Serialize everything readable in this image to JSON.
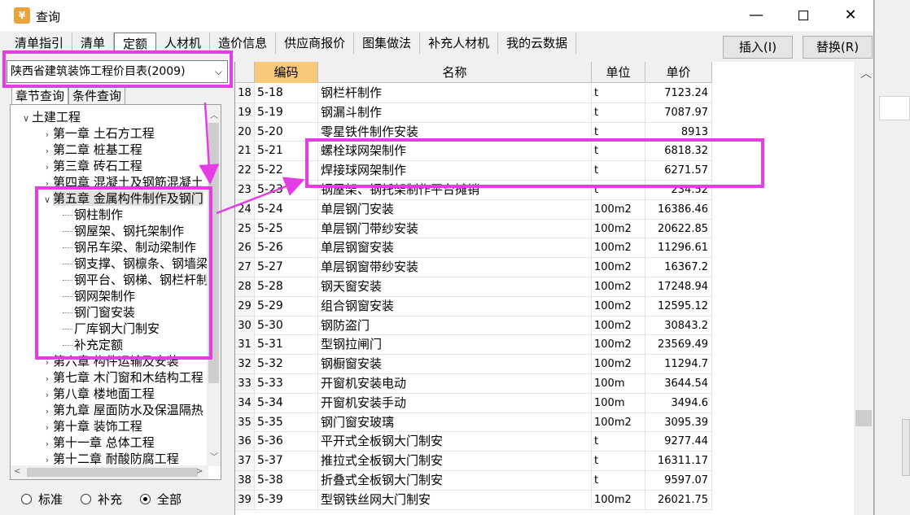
{
  "window": {
    "title": "查询",
    "minimize": "—",
    "close": "✕"
  },
  "tabs": [
    "清单指引",
    "清单",
    "定额",
    "人材机",
    "造价信息",
    "供应商报价",
    "图集做法",
    "补充人材机",
    "我的云数据"
  ],
  "active_tab": "定额",
  "buttons": {
    "insert": "插入(I)",
    "replace": "替换(R)"
  },
  "catalog": {
    "value": "陕西省建筑装饰工程价目表(2009)",
    "arrow": "⌵"
  },
  "subtabs": [
    "章节查询",
    "条件查询"
  ],
  "tree": [
    {
      "label": "土建工程",
      "level": 0,
      "expanded": true
    },
    {
      "label": "第一章 土石方工程",
      "level": 1,
      "expanded": false
    },
    {
      "label": "第二章 桩基工程",
      "level": 1,
      "expanded": false
    },
    {
      "label": "第三章 砖石工程",
      "level": 1,
      "expanded": false
    },
    {
      "label": "第四章 混凝土及钢筋混凝土",
      "level": 1,
      "expanded": false
    },
    {
      "label": "第五章 金属构件制作及钢门",
      "level": 1,
      "expanded": true
    },
    {
      "label": "钢柱制作",
      "level": 2
    },
    {
      "label": "钢屋架、钢托架制作",
      "level": 2
    },
    {
      "label": "钢吊车梁、制动梁制作",
      "level": 2
    },
    {
      "label": "钢支撑、钢檩条、钢墙梁",
      "level": 2
    },
    {
      "label": "钢平台、钢梯、钢栏杆制",
      "level": 2
    },
    {
      "label": "钢网架制作",
      "level": 2
    },
    {
      "label": "钢门窗安装",
      "level": 2
    },
    {
      "label": "厂库钢大门制安",
      "level": 2
    },
    {
      "label": "补充定额",
      "level": 2
    },
    {
      "label": "第六章 构件运输及安装",
      "level": 1,
      "expanded": false
    },
    {
      "label": "第七章 木门窗和木结构工程",
      "level": 1,
      "expanded": false
    },
    {
      "label": "第八章 楼地面工程",
      "level": 1,
      "expanded": false
    },
    {
      "label": "第九章 屋面防水及保温隔热",
      "level": 1,
      "expanded": false
    },
    {
      "label": "第十章 装饰工程",
      "level": 1,
      "expanded": false
    },
    {
      "label": "第十一章 总体工程",
      "level": 1,
      "expanded": false
    },
    {
      "label": "第十二章 耐酸防腐工程",
      "level": 1,
      "expanded": false
    }
  ],
  "radios": [
    {
      "label": "标准",
      "checked": false
    },
    {
      "label": "补充",
      "checked": false
    },
    {
      "label": "全部",
      "checked": true
    }
  ],
  "grid": {
    "headers": {
      "idx": "",
      "code": "编码",
      "name": "名称",
      "unit": "单位",
      "price": "单价"
    },
    "rows": [
      {
        "idx": "18",
        "code": "5-18",
        "name": "钢栏杆制作",
        "unit": "t",
        "price": "7123.24"
      },
      {
        "idx": "19",
        "code": "5-19",
        "name": "钢漏斗制作",
        "unit": "t",
        "price": "7087.97"
      },
      {
        "idx": "20",
        "code": "5-20",
        "name": "零星铁件制作安装",
        "unit": "t",
        "price": "8913"
      },
      {
        "idx": "21",
        "code": "5-21",
        "name": "螺栓球网架制作",
        "unit": "t",
        "price": "6818.32"
      },
      {
        "idx": "22",
        "code": "5-22",
        "name": "焊接球网架制作",
        "unit": "t",
        "price": "6271.57"
      },
      {
        "idx": "23",
        "code": "5-23",
        "name": "钢屋架、钢托架制作平台摊销",
        "unit": "t",
        "price": "234.52"
      },
      {
        "idx": "24",
        "code": "5-24",
        "name": "单层钢门安装",
        "unit": "100m2",
        "price": "16386.46"
      },
      {
        "idx": "25",
        "code": "5-25",
        "name": "单层钢门带纱安装",
        "unit": "100m2",
        "price": "20622.85"
      },
      {
        "idx": "26",
        "code": "5-26",
        "name": "单层钢窗安装",
        "unit": "100m2",
        "price": "11296.61"
      },
      {
        "idx": "27",
        "code": "5-27",
        "name": "单层钢窗带纱安装",
        "unit": "100m2",
        "price": "16367.2"
      },
      {
        "idx": "28",
        "code": "5-28",
        "name": "钢天窗安装",
        "unit": "100m2",
        "price": "17248.94"
      },
      {
        "idx": "29",
        "code": "5-29",
        "name": "组合钢窗安装",
        "unit": "100m2",
        "price": "12595.12"
      },
      {
        "idx": "30",
        "code": "5-30",
        "name": "钢防盗门",
        "unit": "100m2",
        "price": "30843.2"
      },
      {
        "idx": "31",
        "code": "5-31",
        "name": "型钢拉闸门",
        "unit": "100m2",
        "price": "23569.49"
      },
      {
        "idx": "32",
        "code": "5-32",
        "name": "钢橱窗安装",
        "unit": "100m2",
        "price": "11294.7"
      },
      {
        "idx": "33",
        "code": "5-33",
        "name": "开窗机安装电动",
        "unit": "100m",
        "price": "3644.54"
      },
      {
        "idx": "34",
        "code": "5-34",
        "name": "开窗机安装手动",
        "unit": "100m",
        "price": "3494.6"
      },
      {
        "idx": "35",
        "code": "5-35",
        "name": "钢门窗安玻璃",
        "unit": "100m2",
        "price": "3095.39"
      },
      {
        "idx": "36",
        "code": "5-36",
        "name": "平开式全板钢大门制安",
        "unit": "t",
        "price": "9277.44"
      },
      {
        "idx": "37",
        "code": "5-37",
        "name": "推拉式全板钢大门制安",
        "unit": "t",
        "price": "16311.17"
      },
      {
        "idx": "38",
        "code": "5-38",
        "name": "折叠式全板钢大门制安",
        "unit": "t",
        "price": "9597.07"
      },
      {
        "idx": "39",
        "code": "5-39",
        "name": "型钢铁丝网大门制安",
        "unit": "100m2",
        "price": "26021.75"
      }
    ]
  },
  "annotation_color": "#e33ee6"
}
